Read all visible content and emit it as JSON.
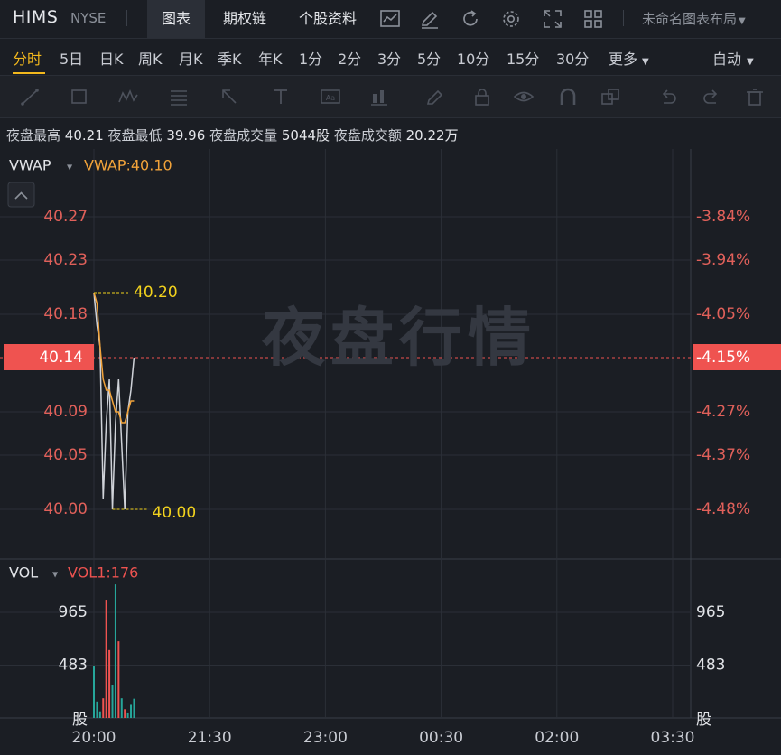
{
  "header": {
    "ticker": "HIMS",
    "exchange": "NYSE",
    "tabs": [
      {
        "label": "图表",
        "active": true
      },
      {
        "label": "期权链",
        "active": false
      },
      {
        "label": "个股资料",
        "active": false
      }
    ],
    "icons": [
      "indicator-icon",
      "draw-icon",
      "refresh-icon",
      "settings-icon",
      "fullscreen-icon",
      "grid-layout-icon"
    ],
    "layout_name": "未命名图表布局"
  },
  "periods": {
    "items": [
      "分时",
      "5日",
      "日K",
      "周K",
      "月K",
      "季K",
      "年K",
      "1分",
      "2分",
      "3分",
      "5分",
      "10分",
      "15分",
      "30分",
      "更多"
    ],
    "active": "分时",
    "mode": "自动"
  },
  "drawing_tools": [
    "line-tool-icon",
    "rectangle-tool-icon",
    "pattern-tool-icon",
    "fib-tool-icon",
    "arrow-tool-icon",
    "text-tool-icon",
    "label-tool-icon",
    "candle-tool-icon",
    "pencil-icon",
    "lock-icon",
    "eye-icon",
    "magnet-icon",
    "layers-icon",
    "undo-icon",
    "redo-icon",
    "trash-icon"
  ],
  "stats": {
    "high_label": "夜盘最高",
    "high": "40.21",
    "low_label": "夜盘最低",
    "low": "39.96",
    "vol_label": "夜盘成交量",
    "vol": "5044股",
    "amt_label": "夜盘成交额",
    "amt": "20.22万"
  },
  "watermark": "夜盘行情",
  "colors": {
    "bg": "#1b1e24",
    "grid": "#2b2f37",
    "price_axis": "#e0605a",
    "current_price_bg": "#ef5350",
    "vwap": "#f2a33a",
    "price_line": "#cfd2d8",
    "annotation": "#f2d21d",
    "vol_up": "#26a69a",
    "vol_down": "#ef5350"
  },
  "chart_data": {
    "type": "line",
    "price_panel": {
      "indicator_label": "VWAP",
      "indicator_value": "VWAP:40.10",
      "y_ticks": [
        "40.27",
        "40.23",
        "40.18",
        "40.14",
        "40.09",
        "40.05",
        "40.00"
      ],
      "y_tick_values": [
        40.27,
        40.23,
        40.18,
        40.14,
        40.09,
        40.05,
        40.0
      ],
      "pct_ticks": [
        "-3.84%",
        "-3.94%",
        "-4.05%",
        "-4.15%",
        "-4.27%",
        "-4.37%",
        "-4.48%"
      ],
      "current_price": "40.14",
      "current_pct": "-4.15%",
      "max_label": "40.20",
      "min_label": "40.00",
      "ylim": [
        39.985,
        40.295
      ],
      "price_series": {
        "x": [
          0.0,
          0.04,
          0.08,
          0.12,
          0.16,
          0.2,
          0.24,
          0.28,
          0.32,
          0.36,
          0.4,
          0.44,
          0.48,
          0.52
        ],
        "y": [
          40.2,
          40.17,
          40.15,
          40.01,
          40.08,
          40.12,
          40.0,
          40.08,
          40.12,
          40.06,
          40.0,
          40.09,
          40.11,
          40.14
        ]
      },
      "vwap_series": {
        "x": [
          0.0,
          0.04,
          0.08,
          0.12,
          0.16,
          0.2,
          0.24,
          0.28,
          0.32,
          0.36,
          0.4,
          0.44,
          0.48,
          0.52
        ],
        "y": [
          40.2,
          40.19,
          40.15,
          40.12,
          40.11,
          40.11,
          40.1,
          40.09,
          40.09,
          40.08,
          40.08,
          40.09,
          40.1,
          40.1
        ]
      }
    },
    "volume_panel": {
      "indicator_label": "VOL",
      "indicator_value": "VOL1:176",
      "y_ticks": [
        "965",
        "483"
      ],
      "y_tick_values": [
        965,
        483
      ],
      "unit": "股",
      "ylim": [
        0,
        1320
      ],
      "bars": [
        {
          "x": 0.0,
          "v": 470,
          "dir": "up"
        },
        {
          "x": 0.04,
          "v": 150,
          "dir": "up"
        },
        {
          "x": 0.08,
          "v": 60,
          "dir": "up"
        },
        {
          "x": 0.12,
          "v": 180,
          "dir": "down"
        },
        {
          "x": 0.16,
          "v": 1080,
          "dir": "down"
        },
        {
          "x": 0.2,
          "v": 620,
          "dir": "down"
        },
        {
          "x": 0.24,
          "v": 300,
          "dir": "up"
        },
        {
          "x": 0.28,
          "v": 1220,
          "dir": "up"
        },
        {
          "x": 0.32,
          "v": 700,
          "dir": "down"
        },
        {
          "x": 0.36,
          "v": 180,
          "dir": "up"
        },
        {
          "x": 0.4,
          "v": 80,
          "dir": "down"
        },
        {
          "x": 0.44,
          "v": 50,
          "dir": "up"
        },
        {
          "x": 0.48,
          "v": 120,
          "dir": "up"
        },
        {
          "x": 0.52,
          "v": 176,
          "dir": "up"
        }
      ]
    },
    "x_ticks": [
      "20:00",
      "21:30",
      "23:00",
      "00:30",
      "02:00",
      "03:30"
    ],
    "x_tick_hours": [
      0,
      1.5,
      3,
      4.5,
      6,
      7.5
    ],
    "xlim": [
      -0.12,
      7.88
    ]
  }
}
